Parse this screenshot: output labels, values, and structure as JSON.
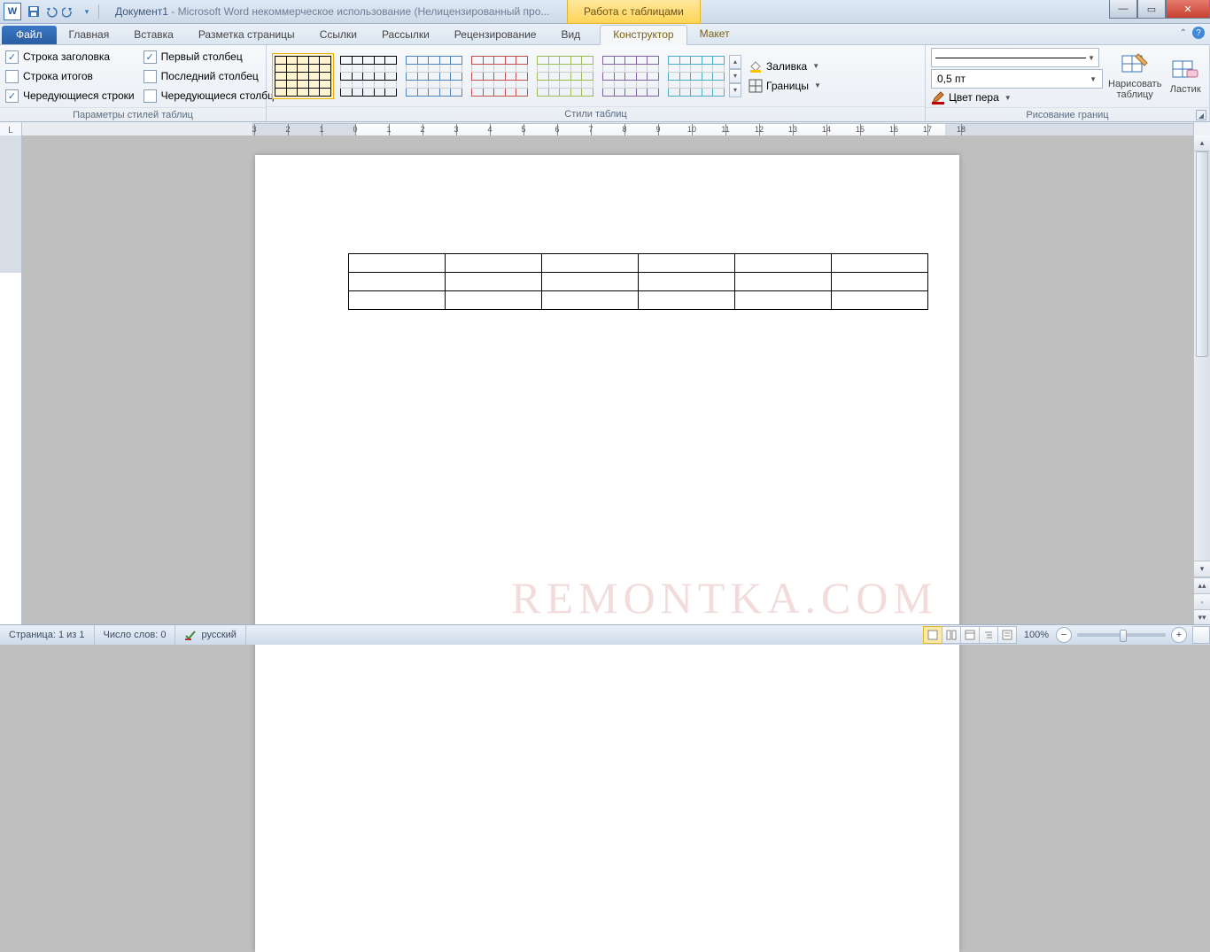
{
  "title": {
    "document": "Документ1",
    "app_suffix": " - Microsoft Word некоммерческое использование (Нелицензированный про...",
    "tool_tab": "Работа с таблицами"
  },
  "tabs": {
    "file": "Файл",
    "items": [
      "Главная",
      "Вставка",
      "Разметка страницы",
      "Ссылки",
      "Рассылки",
      "Рецензирование",
      "Вид"
    ],
    "context": [
      "Конструктор",
      "Макет"
    ],
    "active": "Конструктор"
  },
  "groups": {
    "style_options": {
      "label": "Параметры стилей таблиц",
      "left": [
        {
          "label": "Строка заголовка",
          "checked": true
        },
        {
          "label": "Строка итогов",
          "checked": false
        },
        {
          "label": "Чередующиеся строки",
          "checked": true
        }
      ],
      "right": [
        {
          "label": "Первый столбец",
          "checked": true
        },
        {
          "label": "Последний столбец",
          "checked": false
        },
        {
          "label": "Чередующиеся столбцы",
          "checked": false
        }
      ]
    },
    "table_styles": {
      "label": "Стили таблиц",
      "shading": "Заливка",
      "borders": "Границы"
    },
    "draw_borders": {
      "label": "Рисование границ",
      "weight": "0,5 пт",
      "pen_color": "Цвет пера",
      "draw_table": "Нарисовать таблицу",
      "eraser": "Ластик"
    }
  },
  "status": {
    "page": "Страница: 1 из 1",
    "words": "Число слов: 0",
    "language": "русский",
    "zoom": "100%"
  },
  "watermark": "REMONTKA.COM",
  "gallery_colors": [
    "#000",
    "#4f81bd",
    "#c0504d",
    "#9bbb59",
    "#8064a2",
    "#4bacc6"
  ]
}
